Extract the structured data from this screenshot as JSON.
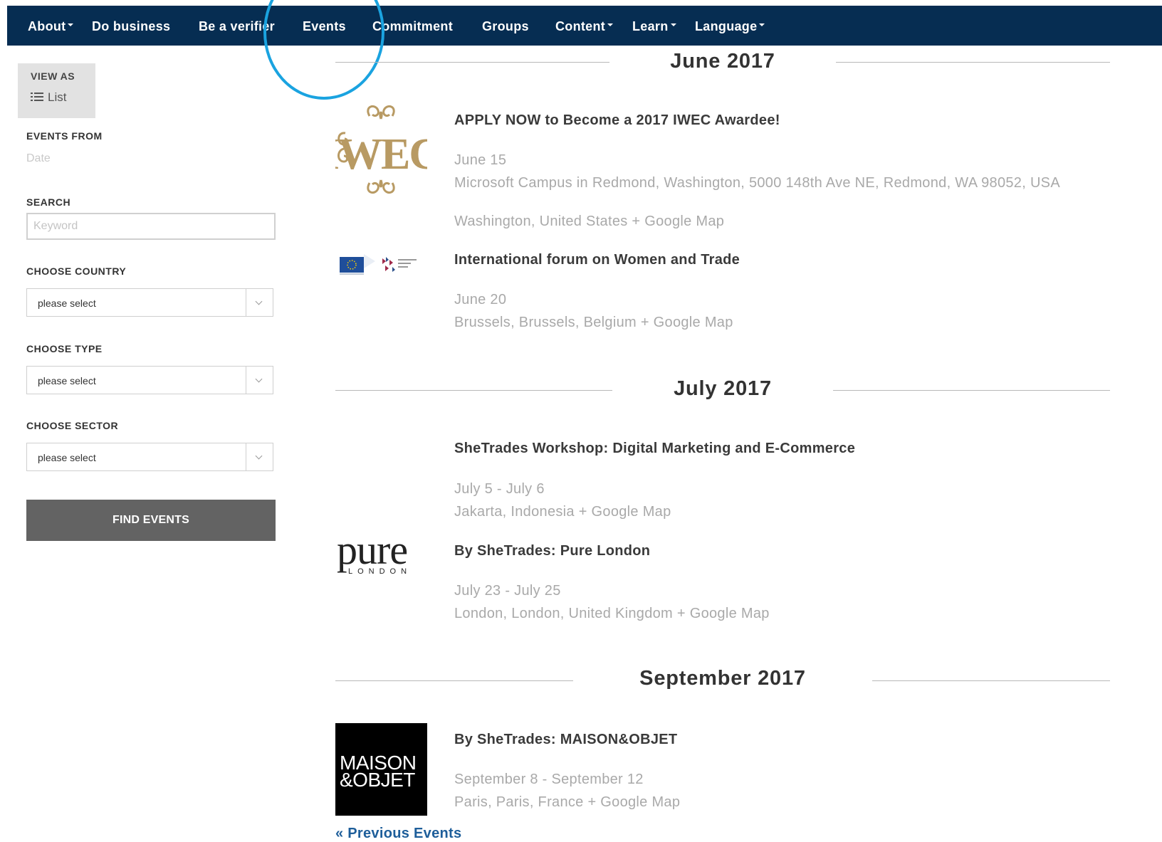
{
  "nav": {
    "items": [
      {
        "label": "About",
        "dropdown": true
      },
      {
        "label": "Do business",
        "dropdown": false
      },
      {
        "label": "Be a verifier",
        "dropdown": false
      },
      {
        "label": "Events",
        "dropdown": false
      },
      {
        "label": "Commitment",
        "dropdown": false
      },
      {
        "label": "Groups",
        "dropdown": false
      },
      {
        "label": "Content",
        "dropdown": true
      },
      {
        "label": "Learn",
        "dropdown": true
      },
      {
        "label": "Language",
        "dropdown": true
      }
    ],
    "highlighted": "Events",
    "bar_color": "#062d52",
    "highlight_color": "#1aa3e0"
  },
  "sidebar": {
    "view_as_label": "VIEW AS",
    "view_as_value": "List",
    "view_as_icon": "list-icon",
    "events_from_label": "EVENTS FROM",
    "date_placeholder": "Date",
    "search_label": "SEARCH",
    "search_placeholder": "Keyword",
    "country_label": "CHOOSE COUNTRY",
    "country_value": "please select",
    "type_label": "CHOOSE TYPE",
    "type_value": "please select",
    "sector_label": "CHOOSE SECTOR",
    "sector_value": "please select",
    "find_button": "FIND EVENTS"
  },
  "months": [
    {
      "title": "June 2017",
      "events": [
        {
          "title": "APPLY NOW to Become a 2017 IWEC Awardee!",
          "date": "June 15",
          "venue": "Microsoft Campus in Redmond, Washington, 5000 148th Ave NE, Redmond, WA 98052, USA",
          "location": "Washington, United States",
          "map_link": "+ Google Map",
          "logo": "IWEC"
        },
        {
          "title": "International forum on Women and Trade",
          "date": "June 20",
          "location": "Brussels, Brussels, Belgium",
          "map_link": "+ Google Map",
          "logo": "eu-itc-logos"
        }
      ]
    },
    {
      "title": "July 2017",
      "events": [
        {
          "title": "SheTrades Workshop: Digital Marketing and E-Commerce",
          "date": "July 5 - July 6",
          "location": "Jakarta, Indonesia",
          "map_link": "+ Google Map"
        },
        {
          "title": "By SheTrades: Pure London",
          "date": "July 23 - July 25",
          "location": "London, London, United Kingdom",
          "map_link": "+ Google Map",
          "logo_main": "pure",
          "logo_sub": "LONDON"
        }
      ]
    },
    {
      "title": "September 2017",
      "events": [
        {
          "title": "By SheTrades: MAISON&OBJET",
          "date": "September 8 - September 12",
          "location": "Paris, Paris, France",
          "map_link": "+ Google Map",
          "logo_line1": "MAISON",
          "logo_line2": "&OBJET"
        }
      ]
    }
  ],
  "previous_link": "« Previous Events",
  "link_color": "#1e5e9a"
}
